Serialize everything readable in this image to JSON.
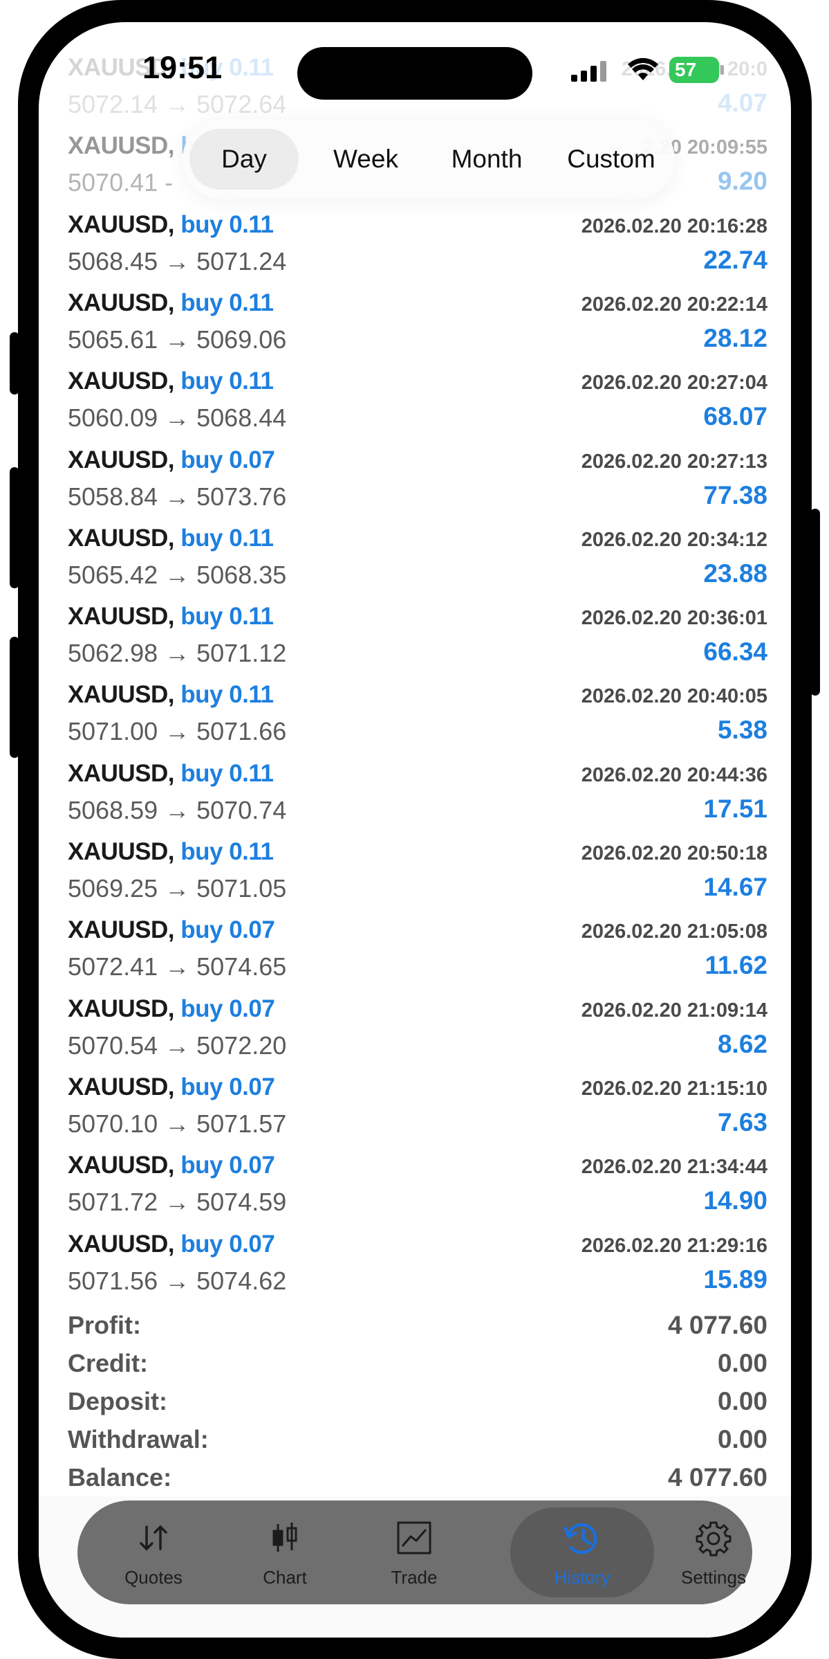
{
  "status": {
    "time": "19:51",
    "battery": "57"
  },
  "segments": [
    {
      "label": "Day",
      "active": true
    },
    {
      "label": "Week",
      "active": false
    },
    {
      "label": "Month",
      "active": false
    },
    {
      "label": "Custom",
      "active": false
    }
  ],
  "trades": [
    {
      "symbol": "XAUUSD,",
      "action": "buy 0.11",
      "time": "2026.02.20 20:0",
      "prices": "5072.14 → 5072.64",
      "profit": "4.07"
    },
    {
      "symbol": "XAUUSD,",
      "action": "bu",
      "time": "2.20 20:09:55",
      "prices": "5070.41 -",
      "profit": "9.20"
    },
    {
      "symbol": "XAUUSD,",
      "action": "buy 0.11",
      "time": "2026.02.20 20:16:28",
      "prices": "5068.45 → 5071.24",
      "profit": "22.74"
    },
    {
      "symbol": "XAUUSD,",
      "action": "buy 0.11",
      "time": "2026.02.20 20:22:14",
      "prices": "5065.61 → 5069.06",
      "profit": "28.12"
    },
    {
      "symbol": "XAUUSD,",
      "action": "buy 0.11",
      "time": "2026.02.20 20:27:04",
      "prices": "5060.09 → 5068.44",
      "profit": "68.07"
    },
    {
      "symbol": "XAUUSD,",
      "action": "buy 0.07",
      "time": "2026.02.20 20:27:13",
      "prices": "5058.84 → 5073.76",
      "profit": "77.38"
    },
    {
      "symbol": "XAUUSD,",
      "action": "buy 0.11",
      "time": "2026.02.20 20:34:12",
      "prices": "5065.42 → 5068.35",
      "profit": "23.88"
    },
    {
      "symbol": "XAUUSD,",
      "action": "buy 0.11",
      "time": "2026.02.20 20:36:01",
      "prices": "5062.98 → 5071.12",
      "profit": "66.34"
    },
    {
      "symbol": "XAUUSD,",
      "action": "buy 0.11",
      "time": "2026.02.20 20:40:05",
      "prices": "5071.00 → 5071.66",
      "profit": "5.38"
    },
    {
      "symbol": "XAUUSD,",
      "action": "buy 0.11",
      "time": "2026.02.20 20:44:36",
      "prices": "5068.59 → 5070.74",
      "profit": "17.51"
    },
    {
      "symbol": "XAUUSD,",
      "action": "buy 0.11",
      "time": "2026.02.20 20:50:18",
      "prices": "5069.25 → 5071.05",
      "profit": "14.67"
    },
    {
      "symbol": "XAUUSD,",
      "action": "buy 0.07",
      "time": "2026.02.20 21:05:08",
      "prices": "5072.41 → 5074.65",
      "profit": "11.62"
    },
    {
      "symbol": "XAUUSD,",
      "action": "buy 0.07",
      "time": "2026.02.20 21:09:14",
      "prices": "5070.54 → 5072.20",
      "profit": "8.62"
    },
    {
      "symbol": "XAUUSD,",
      "action": "buy 0.07",
      "time": "2026.02.20 21:15:10",
      "prices": "5070.10 → 5071.57",
      "profit": "7.63"
    },
    {
      "symbol": "XAUUSD,",
      "action": "buy 0.07",
      "time": "2026.02.20 21:34:44",
      "prices": "5071.72 → 5074.59",
      "profit": "14.90"
    },
    {
      "symbol": "XAUUSD,",
      "action": "buy 0.07",
      "time": "2026.02.20 21:29:16",
      "prices": "5071.56 → 5074.62",
      "profit": "15.89"
    }
  ],
  "summary": [
    {
      "label": "Profit:",
      "value": "4 077.60"
    },
    {
      "label": "Credit:",
      "value": "0.00"
    },
    {
      "label": "Deposit:",
      "value": "0.00"
    },
    {
      "label": "Withdrawal:",
      "value": "0.00"
    },
    {
      "label": "Balance:",
      "value": "4 077.60"
    }
  ],
  "tabs": [
    {
      "label": "Quotes",
      "icon": "quotes-arrows-icon"
    },
    {
      "label": "Chart",
      "icon": "candlestick-icon"
    },
    {
      "label": "Trade",
      "icon": "trade-chart-icon"
    },
    {
      "label": "History",
      "icon": "history-clock-icon",
      "active": true
    },
    {
      "label": "Settings",
      "icon": "gear-icon"
    }
  ],
  "colors": {
    "accent": "#1d7fdf",
    "battery": "#34c759"
  }
}
